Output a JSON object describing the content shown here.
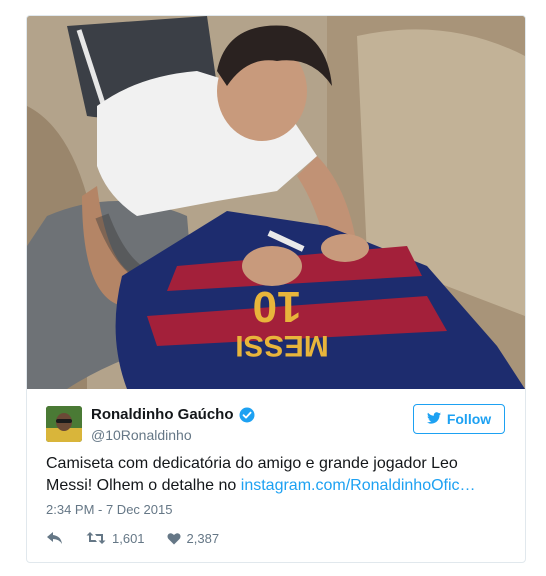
{
  "tweet": {
    "author_name": "Ronaldinho Gaúcho",
    "author_handle": "@10Ronaldinho",
    "follow_label": "Follow",
    "text_main": "Camiseta com dedicatória do amigo e grande jogador Leo Messi! Olhem o detalhe no ",
    "link_text": "instagram.com/RonaldinhoOfic…",
    "timestamp": "2:34 PM - 7 Dec 2015",
    "retweets": "1,601",
    "likes": "2,387"
  },
  "photo": {
    "jersey_number": "10",
    "jersey_name": "MESSI"
  },
  "colors": {
    "accent": "#1da1f2",
    "muted": "#657786",
    "border": "#e1e8ed"
  },
  "icons": [
    "verified-badge-icon",
    "twitter-bird-icon",
    "reply-icon",
    "retweet-icon",
    "like-heart-icon"
  ]
}
